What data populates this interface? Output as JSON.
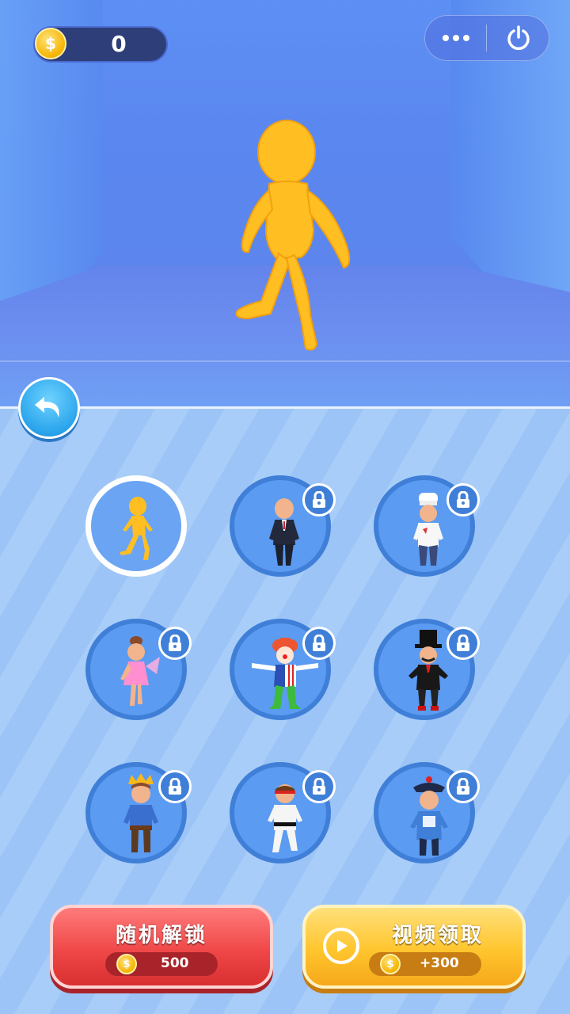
{
  "hud": {
    "coins": "0",
    "more_icon": "more-dots-icon",
    "close_icon": "power-icon"
  },
  "hero": {
    "name": "default-yellow-stickman",
    "color": "#ffbf1f"
  },
  "characters": [
    {
      "id": "default",
      "locked": false,
      "selected": true
    },
    {
      "id": "businessman",
      "locked": true
    },
    {
      "id": "chef",
      "locked": true
    },
    {
      "id": "fairy",
      "locked": true
    },
    {
      "id": "clown",
      "locked": true
    },
    {
      "id": "magician",
      "locked": true
    },
    {
      "id": "prince",
      "locked": true
    },
    {
      "id": "karate",
      "locked": true
    },
    {
      "id": "qing-official",
      "locked": true
    }
  ],
  "buttons": {
    "random_unlock": {
      "label": "随机解锁",
      "price": "500"
    },
    "video_reward": {
      "label": "视频领取",
      "reward": "+300"
    }
  },
  "colors": {
    "accent_red": "#f04848",
    "accent_yellow": "#ffc52e",
    "slot_blue": "#5b9bf1"
  }
}
